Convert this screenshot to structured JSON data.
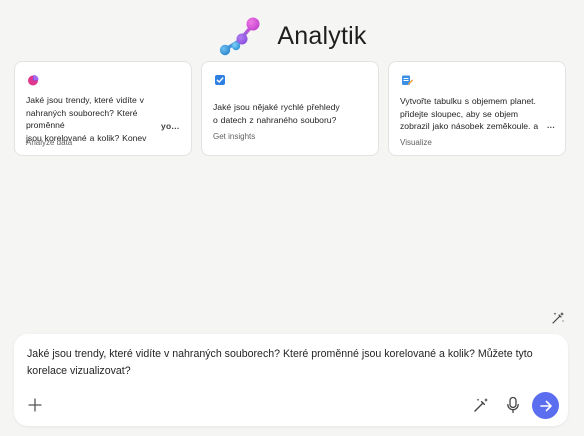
{
  "header": {
    "title": "Analytik",
    "logo_icon": "molecule-logo-icon"
  },
  "cards": [
    {
      "icon": "pie-chart-icon",
      "lines": [
        "Jaké jsou trendy, které vidíte v",
        "nahraných souborech? Které proměnné",
        "jsou korelované a kolik? Konev"
      ],
      "more": "yo...",
      "caption": "Analyze data"
    },
    {
      "icon": "checkbox-icon",
      "lines": [
        "Jaké jsou nějaké rychlé přehledy",
        "o datech z nahraného souboru?"
      ],
      "caption": "Get insights"
    },
    {
      "icon": "clipboard-pencil-icon",
      "lines": [
        "Vytvořte tabulku s objemem planet.",
        "přidejte sloupec, aby se objem",
        "zobrazil jako násobek zeměkoule. a"
      ],
      "more": "...",
      "caption": "Visualize"
    }
  ],
  "composer": {
    "text": "Jaké jsou trendy, které vidíte v nahraných souborech? Které proměnné jsou korelované a kolik? Můžete tyto korelace vizualizovat?",
    "add_icon": "plus-icon",
    "pen_icon": "sparkle-pen-icon",
    "mic_icon": "microphone-icon",
    "send_icon": "arrow-right-icon"
  },
  "sparkle_icon": "sparkle-edit-icon",
  "colors": {
    "background": "#f5f5f4",
    "accent": "#5b6ef0",
    "logo_pink": "#c94bd3",
    "logo_blue": "#2f9bdc"
  }
}
